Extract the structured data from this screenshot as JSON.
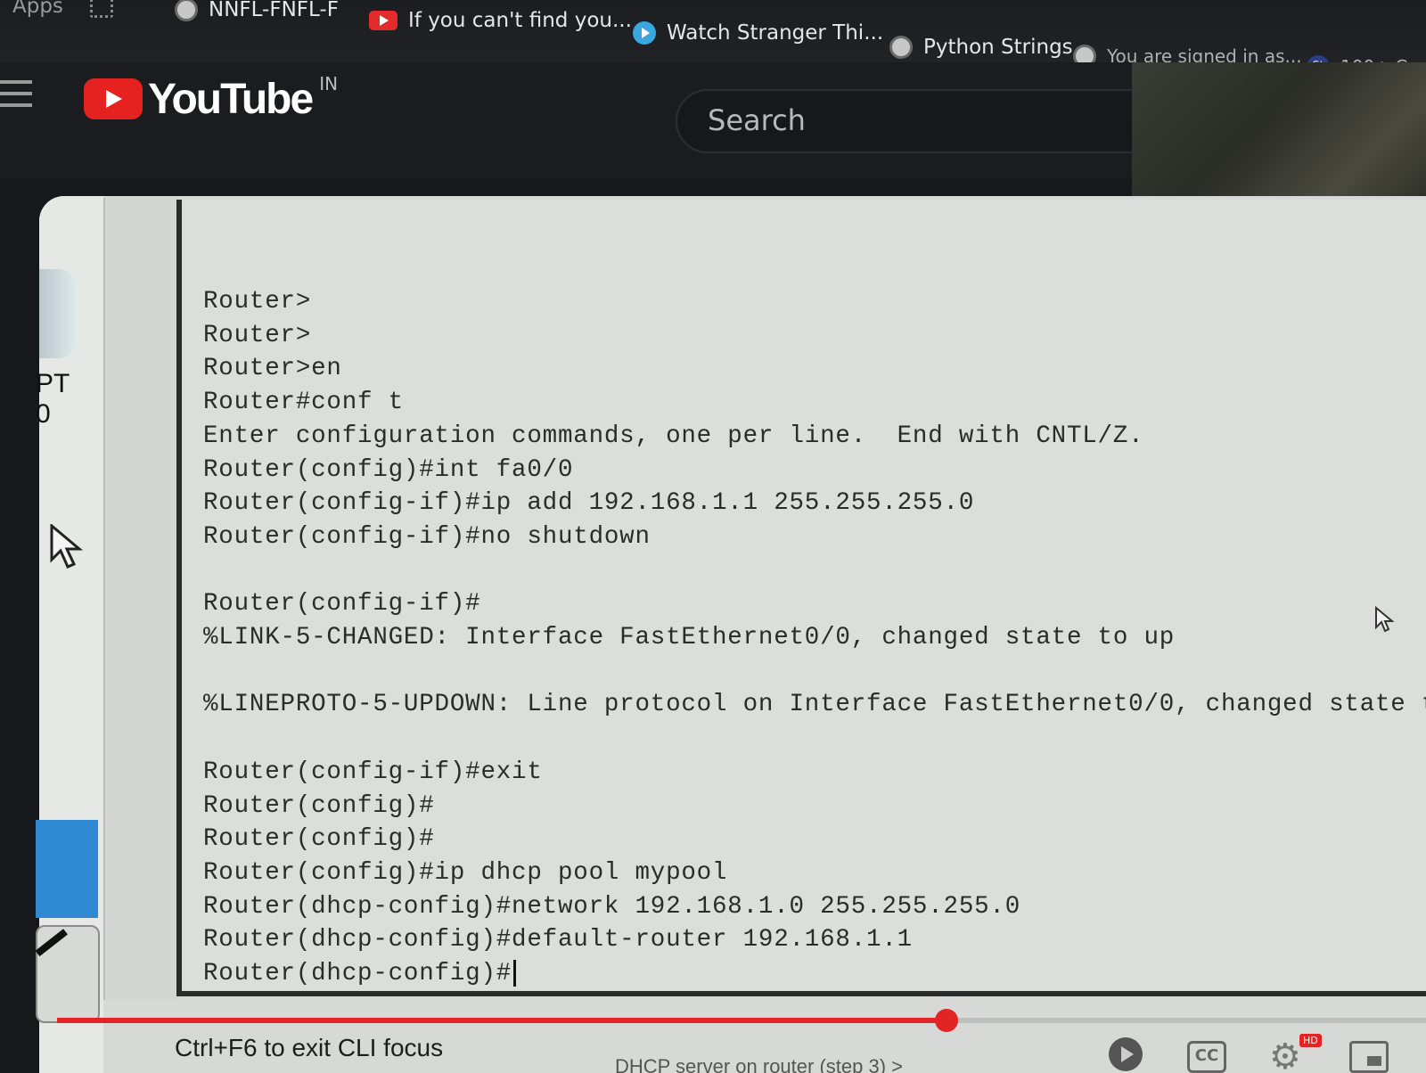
{
  "browser": {
    "bookmarks": [
      {
        "label": "Apps",
        "icon": "apps-grid-icon"
      },
      {
        "label": "NNFL-FNFL-F",
        "icon": "globe-icon"
      },
      {
        "label": "If you can't find you...",
        "icon": "youtube-icon"
      },
      {
        "label": "Watch Stranger Thi...",
        "icon": "play-icon"
      },
      {
        "label": "Python Strings",
        "icon": "globe-icon"
      },
      {
        "label": "You are signed in as...",
        "icon": "globe-icon"
      },
      {
        "label": "100+ C",
        "icon": "st-icon"
      }
    ],
    "st_icon_text": "St"
  },
  "youtube": {
    "logo_text": "YouTube",
    "country_code": "IN",
    "search_placeholder": "Search"
  },
  "app": {
    "left_label_1": "PT",
    "left_label_2": "0"
  },
  "terminal": {
    "lines": [
      "Router>",
      "Router>",
      "Router>en",
      "Router#conf t",
      "Enter configuration commands, one per line.  End with CNTL/Z.",
      "Router(config)#int fa0/0",
      "Router(config-if)#ip add 192.168.1.1 255.255.255.0",
      "Router(config-if)#no shutdown",
      "",
      "Router(config-if)#",
      "%LINK-5-CHANGED: Interface FastEthernet0/0, changed state to up",
      "",
      "%LINEPROTO-5-UPDOWN: Line protocol on Interface FastEthernet0/0, changed state t",
      "",
      "Router(config-if)#exit",
      "Router(config)#",
      "Router(config)#",
      "Router(config)#ip dhcp pool mypool",
      "Router(dhcp-config)#network 192.168.1.0 255.255.255.0",
      "Router(dhcp-config)#default-router 192.168.1.1",
      "Router(dhcp-config)#"
    ]
  },
  "player": {
    "hint": "Ctrl+F6 to exit CLI focus",
    "chapter": "DHCP server on router (step 3) >",
    "cc_label": "CC",
    "hd_badge": "HD",
    "progress_fraction": 0.65,
    "accent_color": "#e22424"
  }
}
